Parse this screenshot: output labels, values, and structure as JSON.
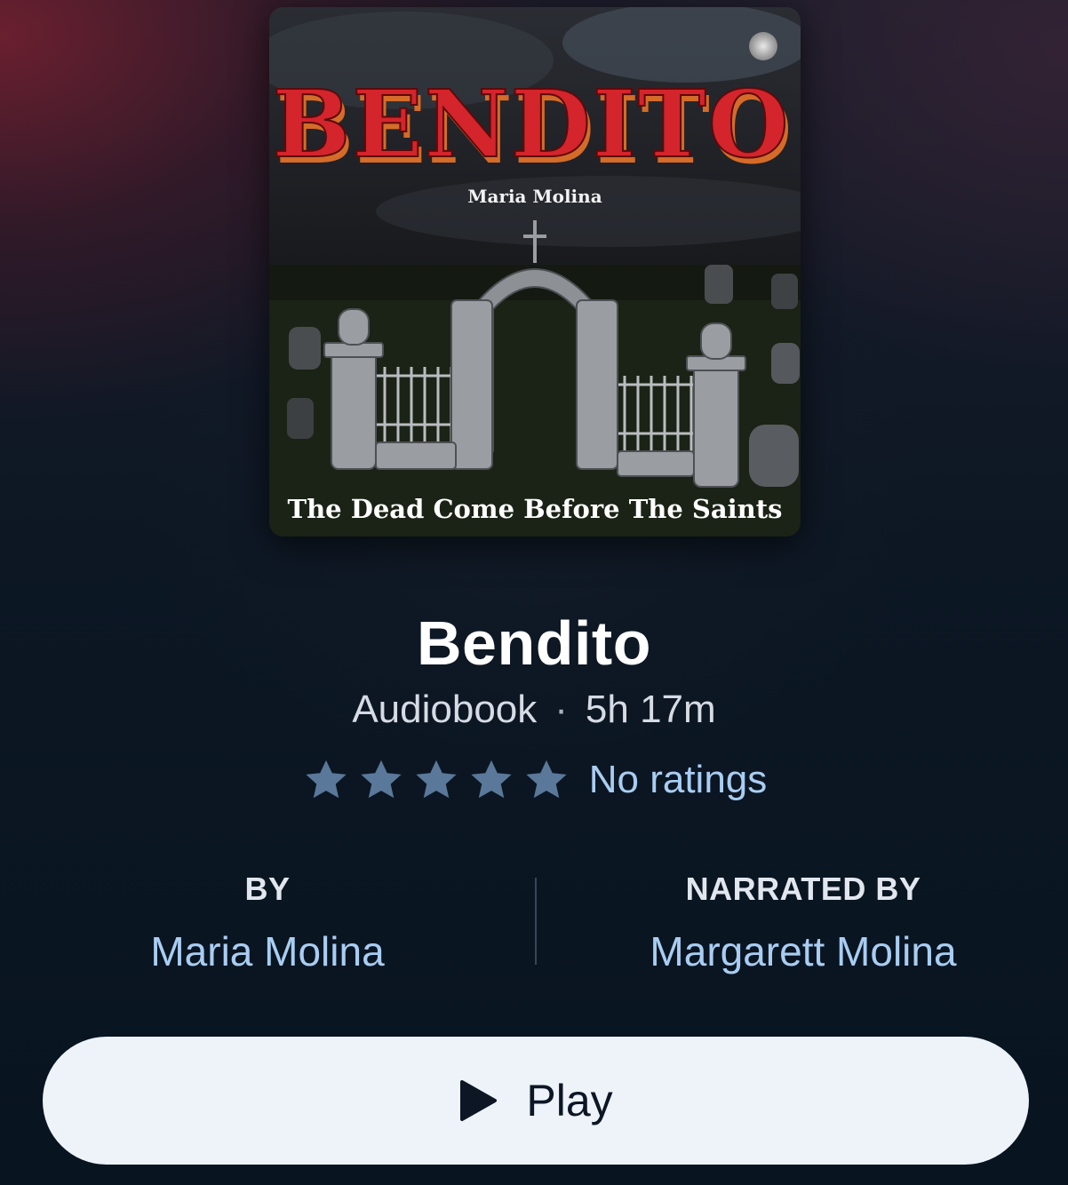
{
  "cover": {
    "title_art": "BENDITO",
    "author_art": "Maria Molina",
    "tagline": "The Dead Come Before The Saints"
  },
  "book": {
    "title": "Bendito",
    "format": "Audiobook",
    "separator": "·",
    "duration": "5h 17m",
    "rating_stars": 5,
    "rating_text": "No ratings"
  },
  "credits": {
    "by_label": "BY",
    "author": "Maria Molina",
    "narrated_label": "NARRATED BY",
    "narrator": "Margarett Molina"
  },
  "actions": {
    "play_label": "Play"
  },
  "colors": {
    "accent_link": "#a9cdf2",
    "star": "#5a7899",
    "button_bg": "#eef3fa"
  }
}
